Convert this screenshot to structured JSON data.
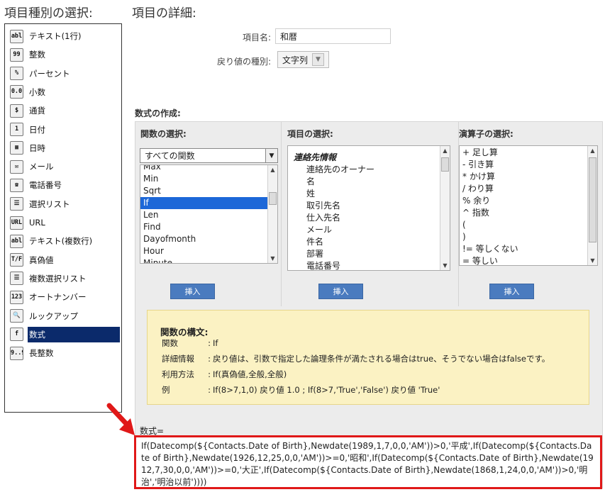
{
  "headings": {
    "type_select": "項目種別の選択:",
    "details": "項目の詳細:"
  },
  "field_types": [
    {
      "label": "テキスト(1行)",
      "icon": "text-single-line-icon",
      "glyph": "abl"
    },
    {
      "label": "整数",
      "icon": "integer-icon",
      "glyph": "99"
    },
    {
      "label": "パーセント",
      "icon": "percent-icon",
      "glyph": "%"
    },
    {
      "label": "小数",
      "icon": "decimal-icon",
      "glyph": "0.0"
    },
    {
      "label": "通貨",
      "icon": "currency-icon",
      "glyph": "$"
    },
    {
      "label": "日付",
      "icon": "date-icon",
      "glyph": "1"
    },
    {
      "label": "日時",
      "icon": "datetime-icon",
      "glyph": "▦"
    },
    {
      "label": "メール",
      "icon": "email-icon",
      "glyph": "✉"
    },
    {
      "label": "電話番号",
      "icon": "phone-icon",
      "glyph": "☎"
    },
    {
      "label": "選択リスト",
      "icon": "picklist-icon",
      "glyph": "☰"
    },
    {
      "label": "URL",
      "icon": "url-icon",
      "glyph": "URL"
    },
    {
      "label": "テキスト(複数行)",
      "icon": "text-multi-line-icon",
      "glyph": "abl"
    },
    {
      "label": "真偽値",
      "icon": "boolean-icon",
      "glyph": "T/F"
    },
    {
      "label": "複数選択リスト",
      "icon": "multi-picklist-icon",
      "glyph": "☰"
    },
    {
      "label": "オートナンバー",
      "icon": "autonumber-icon",
      "glyph": "123"
    },
    {
      "label": "ルックアップ",
      "icon": "lookup-icon",
      "glyph": "🔍"
    },
    {
      "label": "数式",
      "icon": "formula-icon",
      "glyph": "f"
    },
    {
      "label": "長整数",
      "icon": "long-integer-icon",
      "glyph": "9..9"
    }
  ],
  "selected_type": "数式",
  "details": {
    "name_label": "項目名:",
    "name_value": "和暦",
    "return_type_label": "戻り値の種別:",
    "return_type_value": "文字列"
  },
  "formula_builder": {
    "title": "数式の作成:",
    "functions": {
      "header": "関数の選択:",
      "filter": "すべての関数",
      "items": [
        "Max",
        "Min",
        "Sqrt",
        "If",
        "Len",
        "Find",
        "Dayofmonth",
        "Hour",
        "Minute"
      ],
      "selected": "If",
      "insert_label": "挿入"
    },
    "fields": {
      "header": "項目の選択:",
      "group": "連絡先情報",
      "items": [
        "連絡先のオーナー",
        "名",
        "姓",
        "取引先名",
        "仕入先名",
        "メール",
        "件名",
        "部署",
        "電話番号"
      ],
      "insert_label": "挿入"
    },
    "operators": {
      "header": "演算子の選択:",
      "items": [
        "+ 足し算",
        "- 引き算",
        "* かけ算",
        "/ わり算",
        "% 余り",
        "^ 指数",
        "(",
        ")",
        "!= 等しくない",
        "= 等しい"
      ],
      "insert_label": "挿入"
    }
  },
  "syntax": {
    "title": "関数の構文:",
    "rows": [
      {
        "key": "関数",
        "value": "If"
      },
      {
        "key": "詳細情報",
        "value": "戻り値は、引数で指定した論理条件が満たされる場合はtrue、そうでない場合はfalseです。"
      },
      {
        "key": "利用方法",
        "value": "If(真偽値,全般,全般)"
      },
      {
        "key": "例",
        "value": "If(8>7,1,0) 戻り値 1.0 ; If(8>7,'True','False') 戻り値 'True'"
      }
    ]
  },
  "formula": {
    "label": "数式=",
    "value": "If(Datecomp(${Contacts.Date of Birth},Newdate(1989,1,7,0,0,'AM'))>0,'平成',If(Datecomp(${Contacts.Date of Birth},Newdate(1926,12,25,0,0,'AM'))>=0,'昭和',If(Datecomp(${Contacts.Date of Birth},Newdate(1912,7,30,0,0,'AM'))>=0,'大正',If(Datecomp(${Contacts.Date of Birth},Newdate(1868,1,24,0,0,'AM'))>0,'明治','明治以前'))))"
  },
  "colors": {
    "selected_type_bg": "#0b2a6b",
    "highlight_border": "#e01818",
    "syntax_bg": "#fbf2c3",
    "insert_button": "#4a7bbf"
  }
}
